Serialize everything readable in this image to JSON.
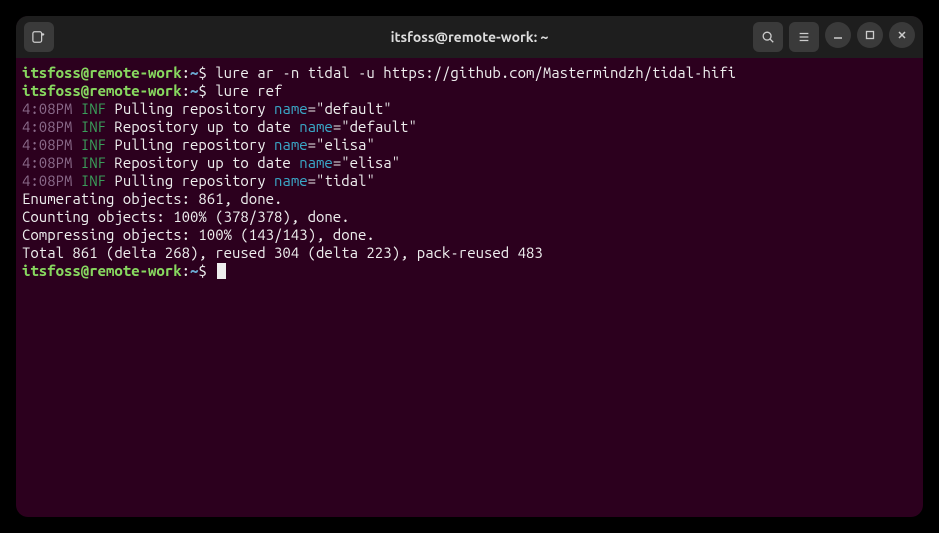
{
  "window": {
    "title": "itsfoss@remote-work: ~"
  },
  "prompt": {
    "user_host": "itsfoss@remote-work",
    "colon": ":",
    "path": "~",
    "dollar": "$"
  },
  "lines": [
    {
      "type": "cmd",
      "text": "lure ar -n tidal -u https://github.com/Mastermindzh/tidal-hifi"
    },
    {
      "type": "cmd",
      "text": "lure ref"
    },
    {
      "type": "log",
      "time": "4:08PM",
      "lvl": "INF",
      "msg": "Pulling repository ",
      "key": "name",
      "val": "=\"default\""
    },
    {
      "type": "log",
      "time": "4:08PM",
      "lvl": "INF",
      "msg": "Repository up to date ",
      "key": "name",
      "val": "=\"default\""
    },
    {
      "type": "log",
      "time": "4:08PM",
      "lvl": "INF",
      "msg": "Pulling repository ",
      "key": "name",
      "val": "=\"elisa\""
    },
    {
      "type": "log",
      "time": "4:08PM",
      "lvl": "INF",
      "msg": "Repository up to date ",
      "key": "name",
      "val": "=\"elisa\""
    },
    {
      "type": "log",
      "time": "4:08PM",
      "lvl": "INF",
      "msg": "Pulling repository ",
      "key": "name",
      "val": "=\"tidal\""
    },
    {
      "type": "plain",
      "text": "Enumerating objects: 861, done."
    },
    {
      "type": "plain",
      "text": "Counting objects: 100% (378/378), done."
    },
    {
      "type": "plain",
      "text": "Compressing objects: 100% (143/143), done."
    },
    {
      "type": "plain",
      "text": "Total 861 (delta 268), reused 304 (delta 223), pack-reused 483"
    },
    {
      "type": "prompt_only"
    }
  ]
}
